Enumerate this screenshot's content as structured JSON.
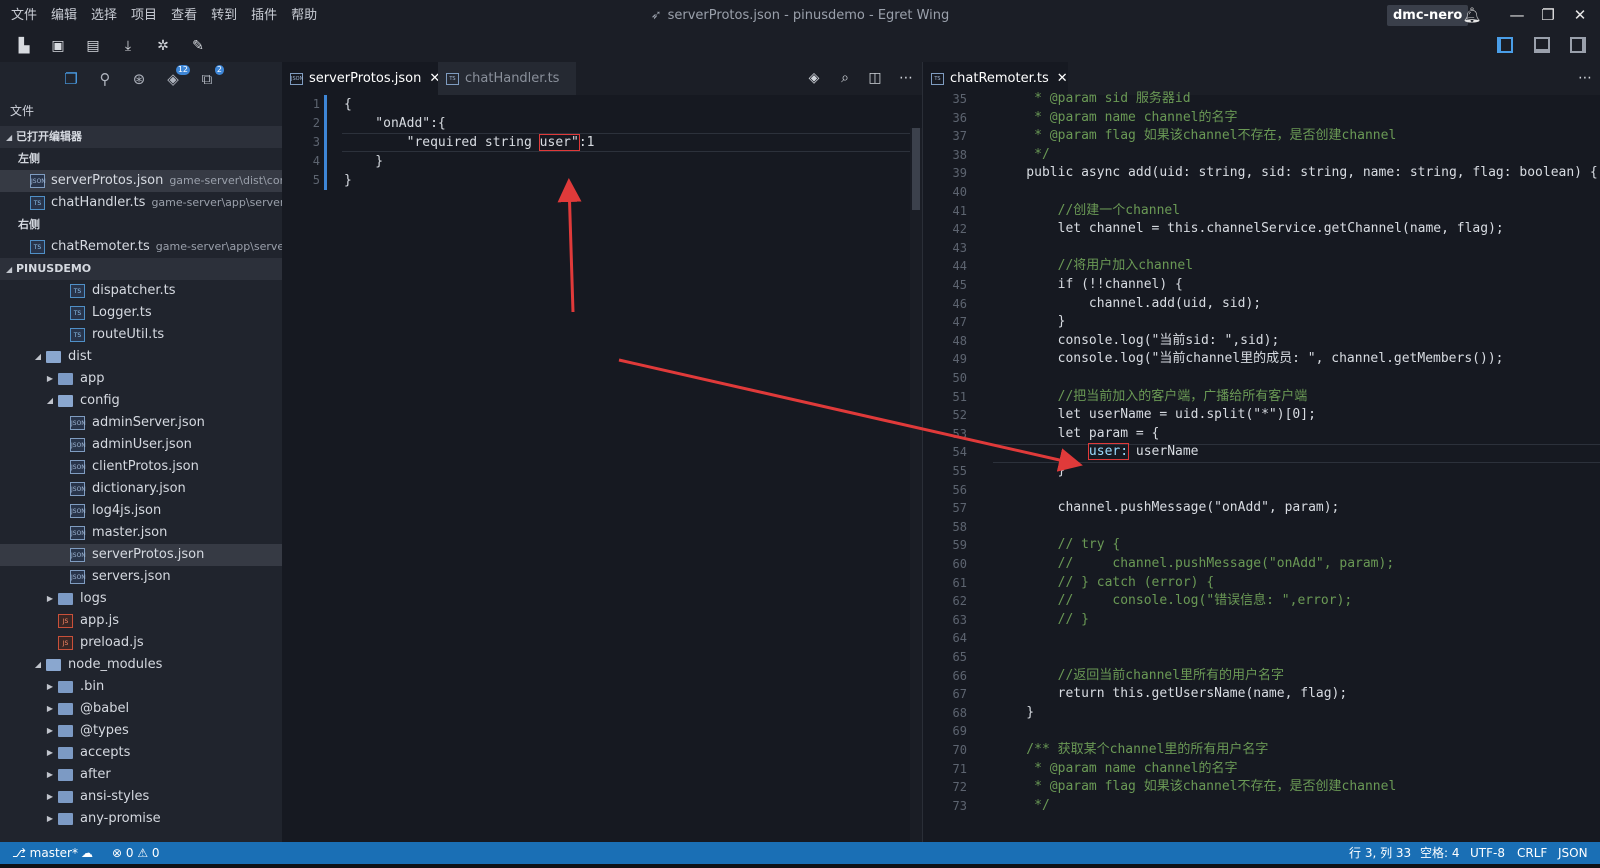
{
  "titlebar": {
    "menu": [
      "文件",
      "编辑",
      "选择",
      "项目",
      "查看",
      "转到",
      "插件",
      "帮助"
    ],
    "title": "serverProtos.json - pinusdemo - Egret Wing",
    "user": "dmc-nero"
  },
  "sidebar": {
    "title": "文件",
    "badges": {
      "git": "12",
      "ext": "2"
    },
    "open_editors_label": "已打开编辑器",
    "left_group_label": "左侧",
    "right_group_label": "右侧",
    "open_editors": [
      {
        "name": "serverProtos.json",
        "path": "game-server\\dist\\config",
        "type": "json"
      },
      {
        "name": "chatHandler.ts",
        "path": "game-server\\app\\servers...",
        "type": "ts"
      },
      {
        "name": "chatRemoter.ts",
        "path": "game-server\\app\\server...",
        "type": "ts"
      }
    ],
    "project_label": "PINUSDEMO",
    "tree": [
      {
        "name": "dispatcher.ts",
        "depth": 3,
        "kind": "ts"
      },
      {
        "name": "Logger.ts",
        "depth": 3,
        "kind": "ts"
      },
      {
        "name": "routeUtil.ts",
        "depth": 3,
        "kind": "ts"
      },
      {
        "name": "dist",
        "depth": 1,
        "kind": "folder-open"
      },
      {
        "name": "app",
        "depth": 2,
        "kind": "folder"
      },
      {
        "name": "config",
        "depth": 2,
        "kind": "folder-open"
      },
      {
        "name": "adminServer.json",
        "depth": 3,
        "kind": "json"
      },
      {
        "name": "adminUser.json",
        "depth": 3,
        "kind": "json"
      },
      {
        "name": "clientProtos.json",
        "depth": 3,
        "kind": "json"
      },
      {
        "name": "dictionary.json",
        "depth": 3,
        "kind": "json"
      },
      {
        "name": "log4js.json",
        "depth": 3,
        "kind": "json"
      },
      {
        "name": "master.json",
        "depth": 3,
        "kind": "json"
      },
      {
        "name": "serverProtos.json",
        "depth": 3,
        "kind": "json",
        "selected": true
      },
      {
        "name": "servers.json",
        "depth": 3,
        "kind": "json"
      },
      {
        "name": "logs",
        "depth": 2,
        "kind": "folder"
      },
      {
        "name": "app.js",
        "depth": 2,
        "kind": "js"
      },
      {
        "name": "preload.js",
        "depth": 2,
        "kind": "js"
      },
      {
        "name": "node_modules",
        "depth": 1,
        "kind": "folder-open"
      },
      {
        "name": ".bin",
        "depth": 2,
        "kind": "folder"
      },
      {
        "name": "@babel",
        "depth": 2,
        "kind": "folder"
      },
      {
        "name": "@types",
        "depth": 2,
        "kind": "folder"
      },
      {
        "name": "accepts",
        "depth": 2,
        "kind": "folder"
      },
      {
        "name": "after",
        "depth": 2,
        "kind": "folder"
      },
      {
        "name": "ansi-styles",
        "depth": 2,
        "kind": "folder"
      },
      {
        "name": "any-promise",
        "depth": 2,
        "kind": "folder"
      }
    ]
  },
  "editor_left": {
    "tabs": [
      {
        "label": "serverProtos.json",
        "active": true
      },
      {
        "label": "chatHandler.ts",
        "active": false
      }
    ],
    "lines": [
      {
        "n": "1",
        "t": "{"
      },
      {
        "n": "2",
        "t": "    \"onAdd\":{"
      },
      {
        "n": "3",
        "pre": "        \"required string ",
        "hl": "user\"",
        "post": ":1"
      },
      {
        "n": "4",
        "t": "    }"
      },
      {
        "n": "5",
        "t": "}"
      }
    ]
  },
  "editor_right": {
    "tab": "chatRemoter.ts",
    "lines": [
      {
        "n": "35",
        "t": "     * @param sid 服务器id",
        "c": "cm"
      },
      {
        "n": "36",
        "t": "     * @param name channel的名字",
        "c": "cm"
      },
      {
        "n": "37",
        "t": "     * @param flag 如果该channel不存在，是否创建channel",
        "c": "cm"
      },
      {
        "n": "38",
        "t": "     */",
        "c": "cm"
      },
      {
        "n": "39",
        "t": "    public async add(uid: string, sid: string, name: string, flag: boolean) {",
        "c": "code"
      },
      {
        "n": "40",
        "t": "",
        "c": "code"
      },
      {
        "n": "41",
        "t": "        //创建一个channel",
        "c": "cm"
      },
      {
        "n": "42",
        "t": "        let channel = this.channelService.getChannel(name, flag);",
        "c": "code"
      },
      {
        "n": "43",
        "t": "",
        "c": "code"
      },
      {
        "n": "44",
        "t": "        //将用户加入channel",
        "c": "cm"
      },
      {
        "n": "45",
        "t": "        if (!!channel) {",
        "c": "code"
      },
      {
        "n": "46",
        "t": "            channel.add(uid, sid);",
        "c": "code"
      },
      {
        "n": "47",
        "t": "        }",
        "c": "code"
      },
      {
        "n": "48",
        "t": "        console.log(\"当前sid: \",sid);",
        "c": "code"
      },
      {
        "n": "49",
        "t": "        console.log(\"当前channel里的成员: \", channel.getMembers());",
        "c": "code"
      },
      {
        "n": "50",
        "t": "",
        "c": "code"
      },
      {
        "n": "51",
        "t": "        //把当前加入的客户端，广播给所有客户端",
        "c": "cm"
      },
      {
        "n": "52",
        "t": "        let userName = uid.split(\"*\")[0];",
        "c": "code"
      },
      {
        "n": "53",
        "t": "        let param = {",
        "c": "code"
      },
      {
        "n": "54",
        "pre": "            ",
        "hl": "user:",
        "post": " userName",
        "c": "code"
      },
      {
        "n": "55",
        "t": "        }",
        "c": "code"
      },
      {
        "n": "56",
        "t": "",
        "c": "code"
      },
      {
        "n": "57",
        "t": "        channel.pushMessage(\"onAdd\", param);",
        "c": "code"
      },
      {
        "n": "58",
        "t": "",
        "c": "code"
      },
      {
        "n": "59",
        "t": "        // try {",
        "c": "cm"
      },
      {
        "n": "60",
        "t": "        //     channel.pushMessage(\"onAdd\", param);",
        "c": "cm"
      },
      {
        "n": "61",
        "t": "        // } catch (error) {",
        "c": "cm"
      },
      {
        "n": "62",
        "t": "        //     console.log(\"错误信息: \",error);",
        "c": "cm"
      },
      {
        "n": "63",
        "t": "        // }",
        "c": "cm"
      },
      {
        "n": "64",
        "t": "",
        "c": "code"
      },
      {
        "n": "65",
        "t": "",
        "c": "code"
      },
      {
        "n": "66",
        "t": "        //返回当前channel里所有的用户名字",
        "c": "cm"
      },
      {
        "n": "67",
        "t": "        return this.getUsersName(name, flag);",
        "c": "code"
      },
      {
        "n": "68",
        "t": "    }",
        "c": "code"
      },
      {
        "n": "69",
        "t": "",
        "c": "code"
      },
      {
        "n": "70",
        "t": "    /** 获取某个channel里的所有用户名字",
        "c": "cm"
      },
      {
        "n": "71",
        "t": "     * @param name channel的名字",
        "c": "cm"
      },
      {
        "n": "72",
        "t": "     * @param flag 如果该channel不存在，是否创建channel",
        "c": "cm"
      },
      {
        "n": "73",
        "t": "     */",
        "c": "cm"
      }
    ]
  },
  "statusbar": {
    "branch": "master*",
    "errors": "0",
    "warnings": "0",
    "position": "行 3, 列 33",
    "spaces": "空格: 4",
    "encoding": "UTF-8",
    "eol": "CRLF",
    "language": "JSON"
  },
  "colors": {
    "accent": "#3e86d6",
    "statusbar": "#1a6fb5",
    "annotation": "#e03a3a"
  }
}
